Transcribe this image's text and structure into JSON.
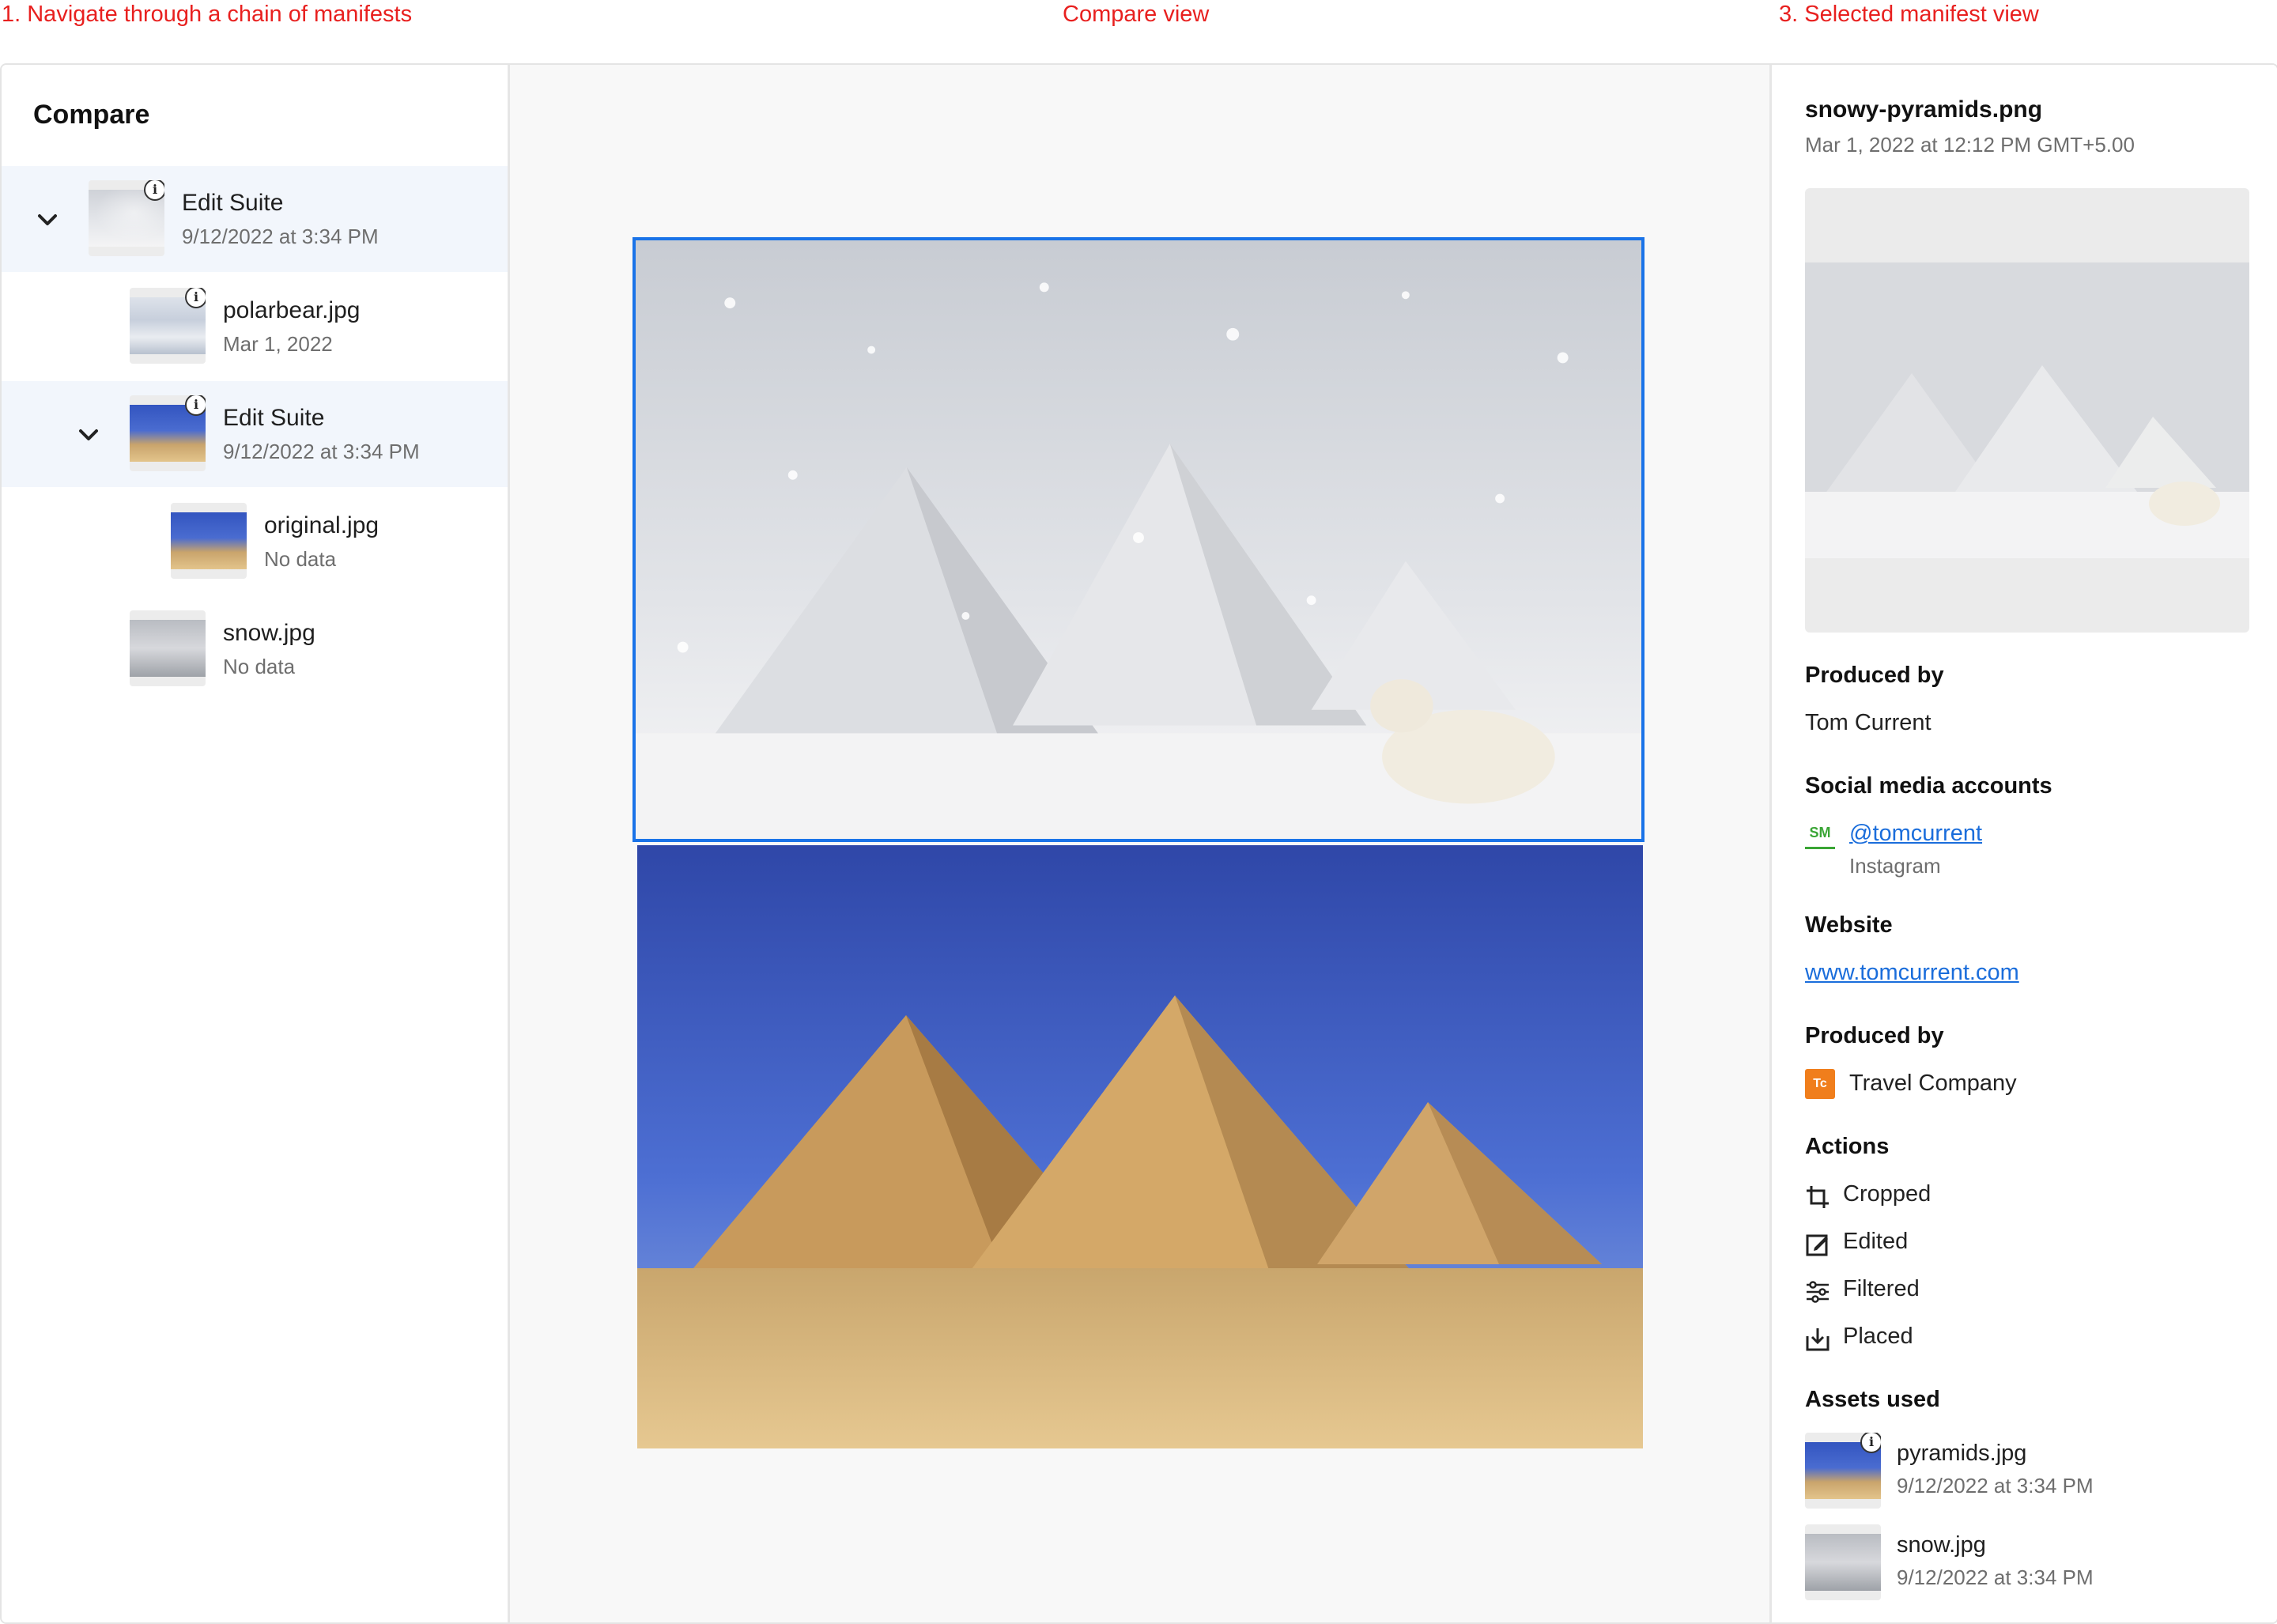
{
  "annotations": {
    "left": "1. Navigate through a chain of manifests",
    "center": "Compare view",
    "right": "3. Selected manifest view"
  },
  "sidebar": {
    "title": "Compare",
    "items": [
      {
        "title": "Edit Suite",
        "subtitle": "9/12/2022 at 3:34 PM",
        "icon": "chevron-down-icon"
      },
      {
        "title": "polarbear.jpg",
        "subtitle": "Mar 1, 2022"
      },
      {
        "title": "Edit Suite",
        "subtitle": "9/12/2022 at 3:34 PM",
        "icon": "chevron-down-icon"
      },
      {
        "title": "original.jpg",
        "subtitle": "No data"
      },
      {
        "title": "snow.jpg",
        "subtitle": "No data"
      }
    ],
    "info_glyph": "i"
  },
  "details": {
    "filename": "snowy-pyramids.png",
    "date": "Mar 1, 2022 at 12:12 PM GMT+5.00",
    "produced_by_label": "Produced by",
    "produced_by_value": "Tom Current",
    "social_label": "Social media accounts",
    "social_badge": "SM",
    "social_handle": "@tomcurrent",
    "social_platform": "Instagram",
    "website_label": "Website",
    "website_value": "www.tomcurrent.com",
    "produced_by_label_2": "Produced by",
    "company_badge": "Tc",
    "company_name": "Travel Company",
    "actions_label": "Actions",
    "actions": [
      {
        "label": "Cropped",
        "icon": "crop-icon"
      },
      {
        "label": "Edited",
        "icon": "edit-icon"
      },
      {
        "label": "Filtered",
        "icon": "filter-sliders-icon"
      },
      {
        "label": "Placed",
        "icon": "place-icon"
      }
    ],
    "assets_label": "Assets used",
    "assets": [
      {
        "title": "pyramids.jpg",
        "subtitle": "9/12/2022 at 3:34 PM"
      },
      {
        "title": "snow.jpg",
        "subtitle": "9/12/2022 at 3:34 PM"
      }
    ]
  },
  "colors": {
    "accent_blue": "#1a73e8",
    "annotation_red": "#e8201f",
    "social_green": "#3aa535",
    "company_orange": "#f07e1c"
  }
}
